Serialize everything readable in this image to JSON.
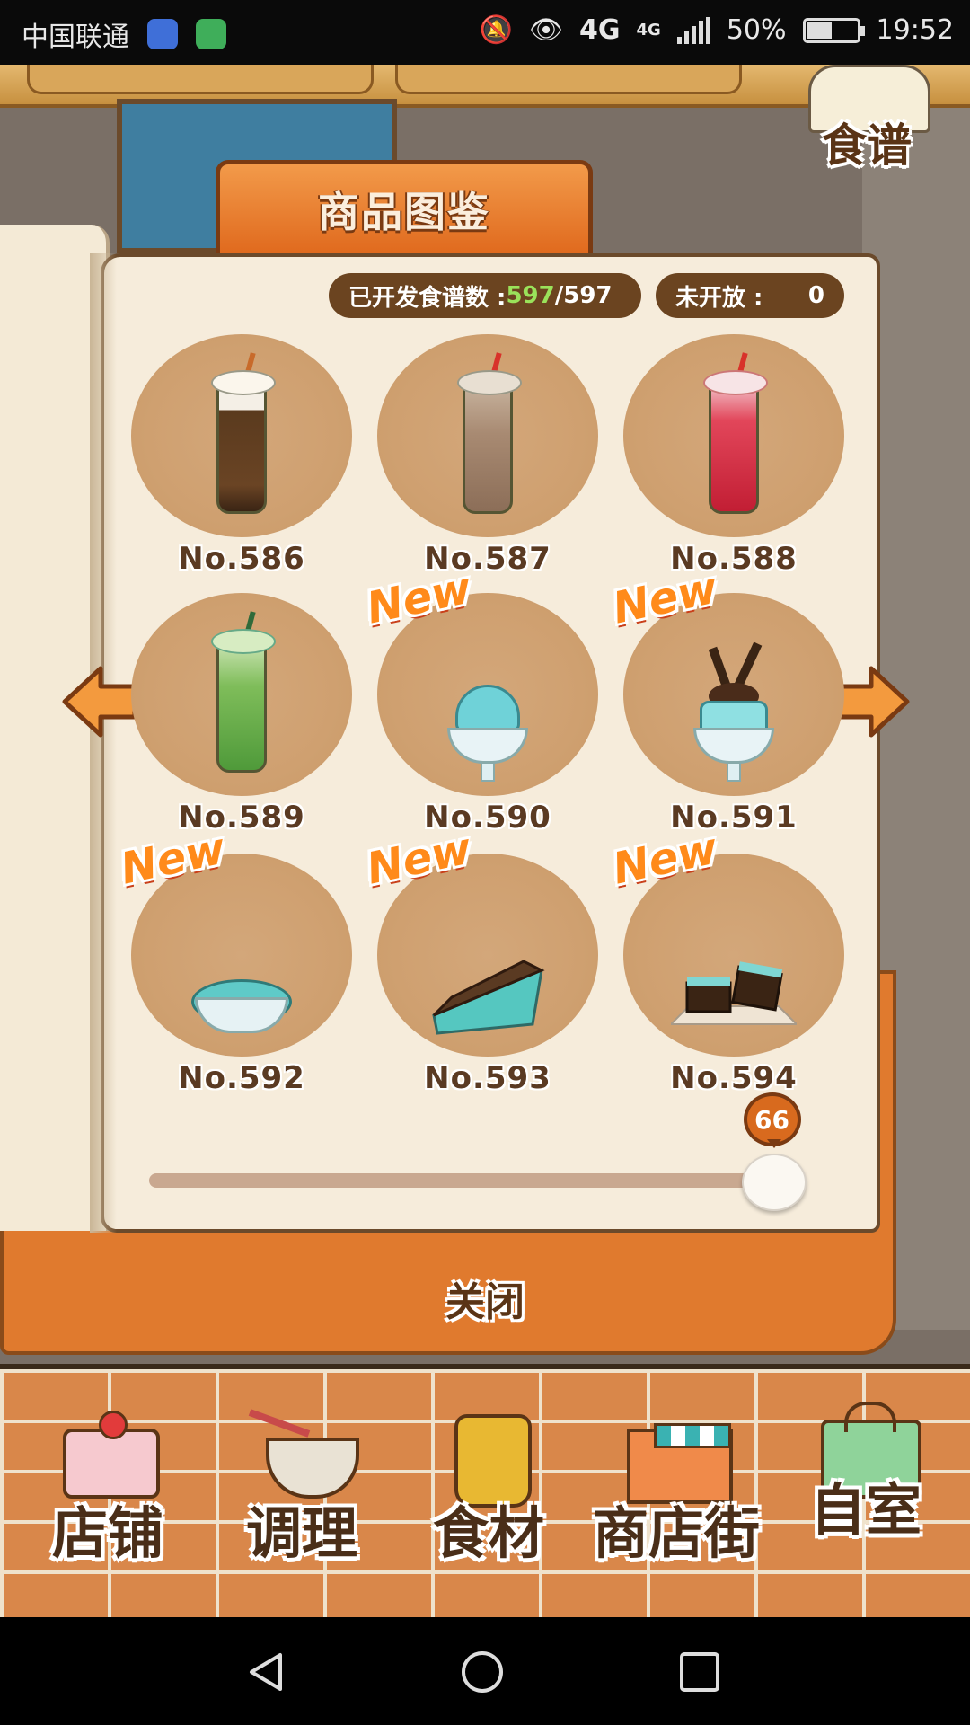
{
  "status_bar": {
    "carrier": "中国联通",
    "network_1": "4G",
    "network_2": "4G",
    "battery": "50%",
    "battery_level": 0.5,
    "time": "19:52"
  },
  "header": {
    "recipe_button_label": "食谱"
  },
  "catalog": {
    "tab_title": "商品图鉴",
    "developed_label": "已开发食谱数 :",
    "developed_count": "597",
    "developed_total": "/597",
    "unopened_label": "未开放 :",
    "unopened_count": "0",
    "new_badge": "New",
    "items": [
      {
        "number": "No.586",
        "is_new": false,
        "kind": "milk-tea-boba"
      },
      {
        "number": "No.587",
        "is_new": false,
        "kind": "chocolate-drink"
      },
      {
        "number": "No.588",
        "is_new": false,
        "kind": "strawberry-drink"
      },
      {
        "number": "No.589",
        "is_new": false,
        "kind": "matcha-drink"
      },
      {
        "number": "No.590",
        "is_new": true,
        "kind": "mint-ice-cream-cup"
      },
      {
        "number": "No.591",
        "is_new": true,
        "kind": "mint-parfait"
      },
      {
        "number": "No.592",
        "is_new": true,
        "kind": "mint-chip-ice-cream"
      },
      {
        "number": "No.593",
        "is_new": true,
        "kind": "mint-cake-slice"
      },
      {
        "number": "No.594",
        "is_new": true,
        "kind": "mint-brownies"
      }
    ],
    "page_slider_value": "66",
    "page_slider_position": 0.95,
    "close_label": "关闭"
  },
  "bottom_nav": [
    {
      "label": "店铺",
      "icon": "cake-icon"
    },
    {
      "label": "调理",
      "icon": "whisk-bowl-icon"
    },
    {
      "label": "食材",
      "icon": "ingredient-bag-icon"
    },
    {
      "label": "商店街",
      "icon": "shop-street-icon"
    },
    {
      "label": "自室",
      "icon": "staff-only-sign-icon"
    }
  ],
  "colors": {
    "accent": "#e06a1e",
    "new_badge": "#ff8a1a",
    "count_green": "#9ae25a",
    "circle_bg": "#cfa070"
  }
}
